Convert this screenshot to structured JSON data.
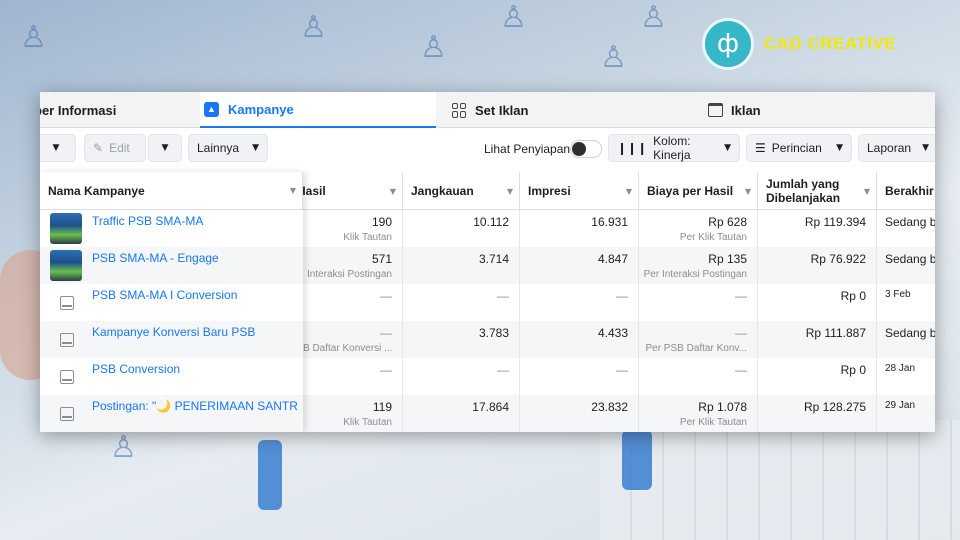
{
  "brand": {
    "logo_text": "CAD CREATIVE",
    "logo_glyph": "ф"
  },
  "tabs": [
    {
      "label": "per Informasi"
    },
    {
      "label": "Kampanye"
    },
    {
      "label": "Set Iklan"
    },
    {
      "label": "Iklan"
    }
  ],
  "toolbar": {
    "edit_label": "Edit",
    "more_label": "Lainnya",
    "preview_label": "Lihat Penyiapan",
    "columns_label": "Kolom: Kinerja",
    "breakdown_label": "Perincian",
    "report_label": "Laporan"
  },
  "headers": {
    "name": "Nama Kampanye",
    "results": "Hasil",
    "reach": "Jangkauan",
    "impressions": "Impresi",
    "cost": "Biaya per Hasil",
    "spent": "Jumlah yang Dibelanjakan",
    "ends": "Berakhir"
  },
  "rows": [
    {
      "name": "Traffic PSB SMA-MA",
      "results": "190",
      "results_sub": "Klik Tautan",
      "reach": "10.112",
      "impressions": "16.931",
      "cost": "Rp 628",
      "cost_sub": "Per Klik Tautan",
      "spent": "Rp 119.394",
      "ends": "Sedang b"
    },
    {
      "name": "PSB SMA-MA - Engage",
      "results": "571",
      "results_sub": "Interaksi Postingan",
      "reach": "3.714",
      "impressions": "4.847",
      "cost": "Rp 135",
      "cost_sub": "Per Interaksi Postingan",
      "spent": "Rp 76.922",
      "ends": "Sedang b"
    },
    {
      "name": "PSB SMA-MA I Conversion",
      "results": "—",
      "results_sub": "",
      "reach": "—",
      "impressions": "—",
      "cost": "—",
      "cost_sub": "",
      "spent": "Rp 0",
      "ends": "3 Feb"
    },
    {
      "name": "Kampanye Konversi Baru PSB",
      "results": "—",
      "results_sub": "B Daftar Konversi ...",
      "reach": "3.783",
      "impressions": "4.433",
      "cost": "—",
      "cost_sub": "Per PSB Daftar Konv...",
      "spent": "Rp 111.887",
      "ends": "Sedang b"
    },
    {
      "name": "PSB Conversion",
      "results": "—",
      "results_sub": "",
      "reach": "—",
      "impressions": "—",
      "cost": "—",
      "cost_sub": "",
      "spent": "Rp 0",
      "ends": "28 Jan"
    },
    {
      "name": "Postingan: \"🌙 PENERIMAAN SANTR...",
      "results": "119",
      "results_sub": "Klik Tautan",
      "reach": "17.864",
      "impressions": "23.832",
      "cost": "Rp 1.078",
      "cost_sub": "Per Klik Tautan",
      "spent": "Rp 128.275",
      "ends": "29 Jan"
    }
  ]
}
